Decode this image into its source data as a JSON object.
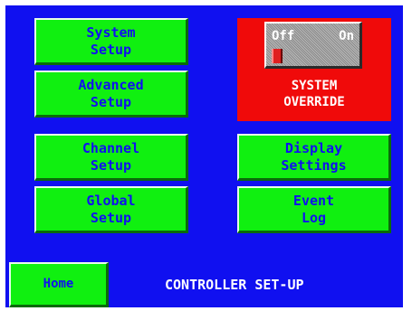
{
  "buttons": {
    "system_setup": [
      "System",
      "Setup"
    ],
    "advanced_setup": [
      "Advanced",
      "Setup"
    ],
    "channel_setup": [
      "Channel",
      "Setup"
    ],
    "global_setup": [
      "Global",
      "Setup"
    ],
    "display_settings": [
      "Display",
      "Settings"
    ],
    "event_log": [
      "Event",
      "Log"
    ],
    "home": "Home"
  },
  "override": {
    "toggle_off_label": "Off",
    "toggle_on_label": "On",
    "state": "off",
    "label": [
      "SYSTEM",
      "OVERRIDE"
    ]
  },
  "screen_title": "CONTROLLER SET-UP",
  "colors": {
    "background": "#1010f0",
    "button_face": "#10f010",
    "button_text": "#1010f0",
    "override_panel": "#f00a0a",
    "toggle_knob": "#e02020",
    "label_text": "#ffffff"
  }
}
